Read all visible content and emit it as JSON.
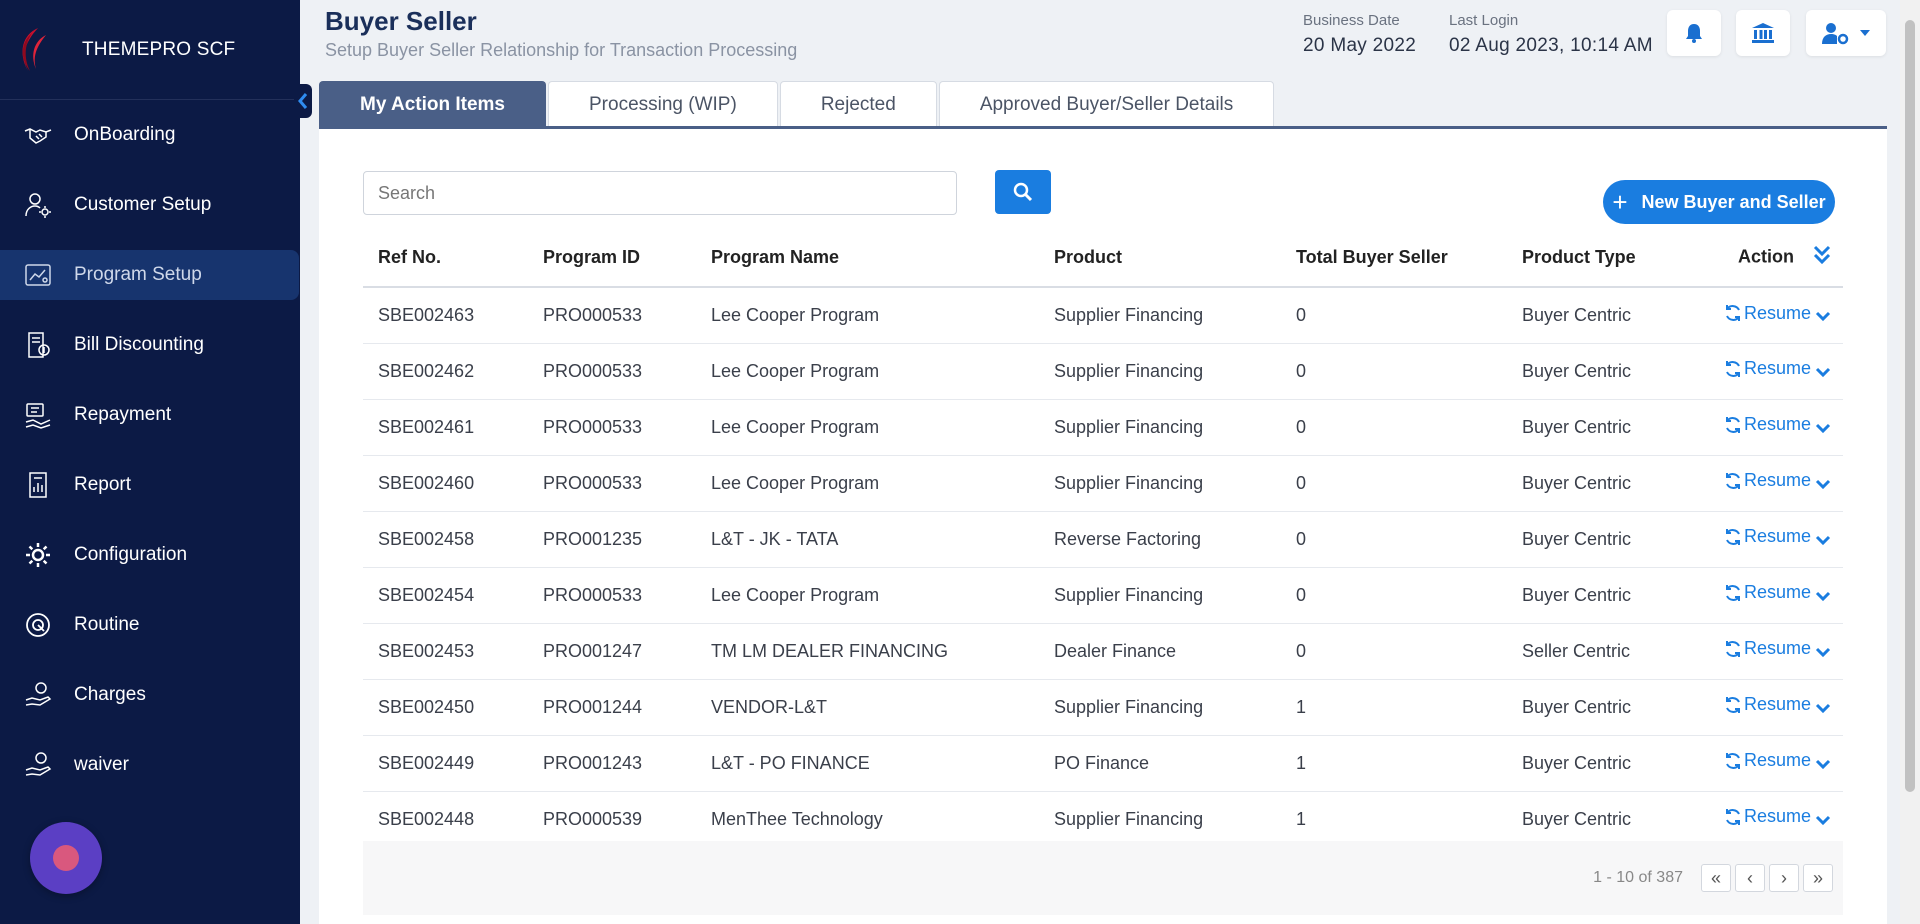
{
  "brand": {
    "name": "THEMEPRO SCF"
  },
  "sidebar": {
    "items": [
      {
        "label": "OnBoarding",
        "icon": "handshake-icon"
      },
      {
        "label": "Customer Setup",
        "icon": "user-gear-icon"
      },
      {
        "label": "Program Setup",
        "icon": "program-icon",
        "active": true
      },
      {
        "label": "Bill Discounting",
        "icon": "bill-icon"
      },
      {
        "label": "Repayment",
        "icon": "repayment-icon"
      },
      {
        "label": "Report",
        "icon": "report-icon"
      },
      {
        "label": "Configuration",
        "icon": "gear-icon"
      },
      {
        "label": "Routine",
        "icon": "routine-icon"
      },
      {
        "label": "Charges",
        "icon": "hand-coin-icon"
      },
      {
        "label": "waiver",
        "icon": "hand-coin-icon"
      }
    ]
  },
  "header": {
    "title": "Buyer Seller",
    "subtitle": "Setup Buyer Seller Relationship for Transaction Processing",
    "business_date_label": "Business Date",
    "business_date": "20 May 2022",
    "last_login_label": "Last Login",
    "last_login": "02 Aug 2023, 10:14 AM"
  },
  "tabs": [
    {
      "label": "My Action Items",
      "active": true
    },
    {
      "label": "Processing (WIP)"
    },
    {
      "label": "Rejected"
    },
    {
      "label": "Approved Buyer/Seller Details"
    }
  ],
  "search": {
    "placeholder": "Search"
  },
  "new_button": {
    "label": "New Buyer and Seller"
  },
  "table": {
    "columns": [
      "Ref No.",
      "Program ID",
      "Program Name",
      "Product",
      "Total Buyer Seller",
      "Product Type",
      "Action"
    ],
    "action_label": "Resume",
    "rows": [
      [
        "SBE002463",
        "PRO000533",
        "Lee Cooper Program",
        "Supplier Financing",
        "0",
        "Buyer Centric"
      ],
      [
        "SBE002462",
        "PRO000533",
        "Lee Cooper Program",
        "Supplier Financing",
        "0",
        "Buyer Centric"
      ],
      [
        "SBE002461",
        "PRO000533",
        "Lee Cooper Program",
        "Supplier Financing",
        "0",
        "Buyer Centric"
      ],
      [
        "SBE002460",
        "PRO000533",
        "Lee Cooper Program",
        "Supplier Financing",
        "0",
        "Buyer Centric"
      ],
      [
        "SBE002458",
        "PRO001235",
        "L&T - JK - TATA",
        "Reverse Factoring",
        "0",
        "Buyer Centric"
      ],
      [
        "SBE002454",
        "PRO000533",
        "Lee Cooper Program",
        "Supplier Financing",
        "0",
        "Buyer Centric"
      ],
      [
        "SBE002453",
        "PRO001247",
        "TM LM DEALER FINANCING",
        "Dealer Finance",
        "0",
        "Seller Centric"
      ],
      [
        "SBE002450",
        "PRO001244",
        "VENDOR-L&T",
        "Supplier Financing",
        "1",
        "Buyer Centric"
      ],
      [
        "SBE002449",
        "PRO001243",
        "L&T - PO FINANCE",
        "PO Finance",
        "1",
        "Buyer Centric"
      ],
      [
        "SBE002448",
        "PRO000539",
        "MenThee Technology",
        "Supplier Financing",
        "1",
        "Buyer Centric"
      ]
    ]
  },
  "pagination": {
    "info": "1 - 10 of 387",
    "first": "«",
    "prev": "‹",
    "next": "›",
    "last": "»"
  },
  "colors": {
    "sidebar_bg": "#0c1a45",
    "accent": "#1a7de0",
    "tab_active": "#4a5f87",
    "chat_button": "#5b3fc4"
  }
}
